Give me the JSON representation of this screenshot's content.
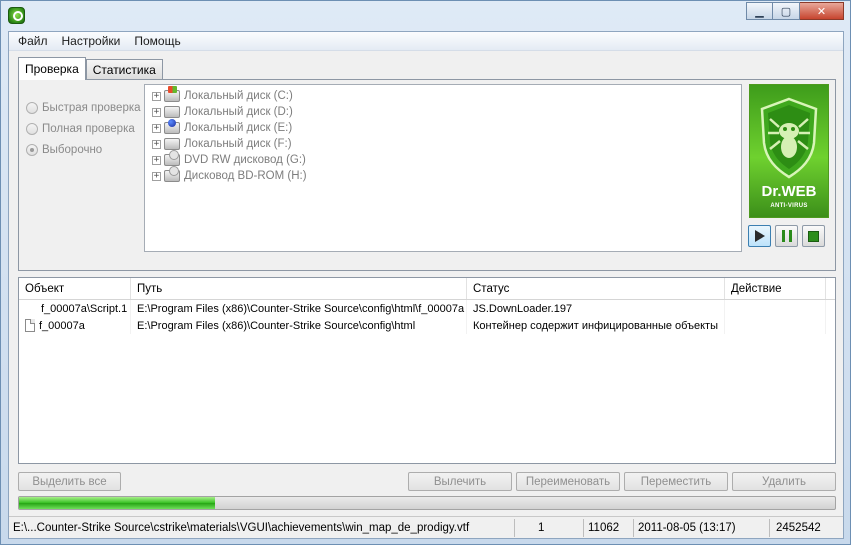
{
  "window": {
    "minimize_glyph": "▁",
    "maximize_glyph": "▢",
    "close_glyph": "✕"
  },
  "menu": {
    "items": [
      "Файл",
      "Настройки",
      "Помощь"
    ]
  },
  "tabs": [
    {
      "label": "Проверка",
      "active": true
    },
    {
      "label": "Статистика",
      "active": false
    }
  ],
  "scan_modes": [
    {
      "label": "Быстрая проверка",
      "checked": false
    },
    {
      "label": "Полная проверка",
      "checked": false
    },
    {
      "label": "Выборочно",
      "checked": true
    }
  ],
  "drives": [
    {
      "label": "Локальный диск (C:)",
      "icon": "system-drive-icon"
    },
    {
      "label": "Локальный диск (D:)",
      "icon": "hard-drive-icon"
    },
    {
      "label": "Локальный диск (E:)",
      "icon": "network-drive-icon"
    },
    {
      "label": "Локальный диск (F:)",
      "icon": "hard-drive-icon"
    },
    {
      "label": "DVD RW дисковод (G:)",
      "icon": "dvd-drive-icon"
    },
    {
      "label": "Дисковод BD-ROM (H:)",
      "icon": "bd-drive-icon"
    }
  ],
  "logo": {
    "name": "Dr.WEB",
    "subtitle": "ANTI-VIRUS"
  },
  "results": {
    "columns": [
      "Объект",
      "Путь",
      "Статус",
      "Действие"
    ],
    "rows": [
      {
        "object": "f_00007a\\Script.1",
        "path": "E:\\Program Files (x86)\\Counter-Strike Source\\config\\html\\f_00007a",
        "status": "JS.DownLoader.197",
        "action": "",
        "has_icon": false
      },
      {
        "object": "f_00007a",
        "path": "E:\\Program Files (x86)\\Counter-Strike Source\\config\\html",
        "status": "Контейнер содержит инфицированные объекты",
        "action": "",
        "has_icon": true
      }
    ]
  },
  "buttons": {
    "select_all": "Выделить все",
    "cure": "Вылечить",
    "rename": "Переименовать",
    "move": "Переместить",
    "delete": "Удалить"
  },
  "progress": {
    "fraction": 0.24
  },
  "status": {
    "current_file": "E:\\...Counter-Strike Source\\cstrike\\materials\\VGUI\\achievements\\win_map_de_prodigy.vtf",
    "infected": "1",
    "checked": "11062",
    "datetime": "2011-08-05 (13:17)",
    "count": "2452542"
  }
}
